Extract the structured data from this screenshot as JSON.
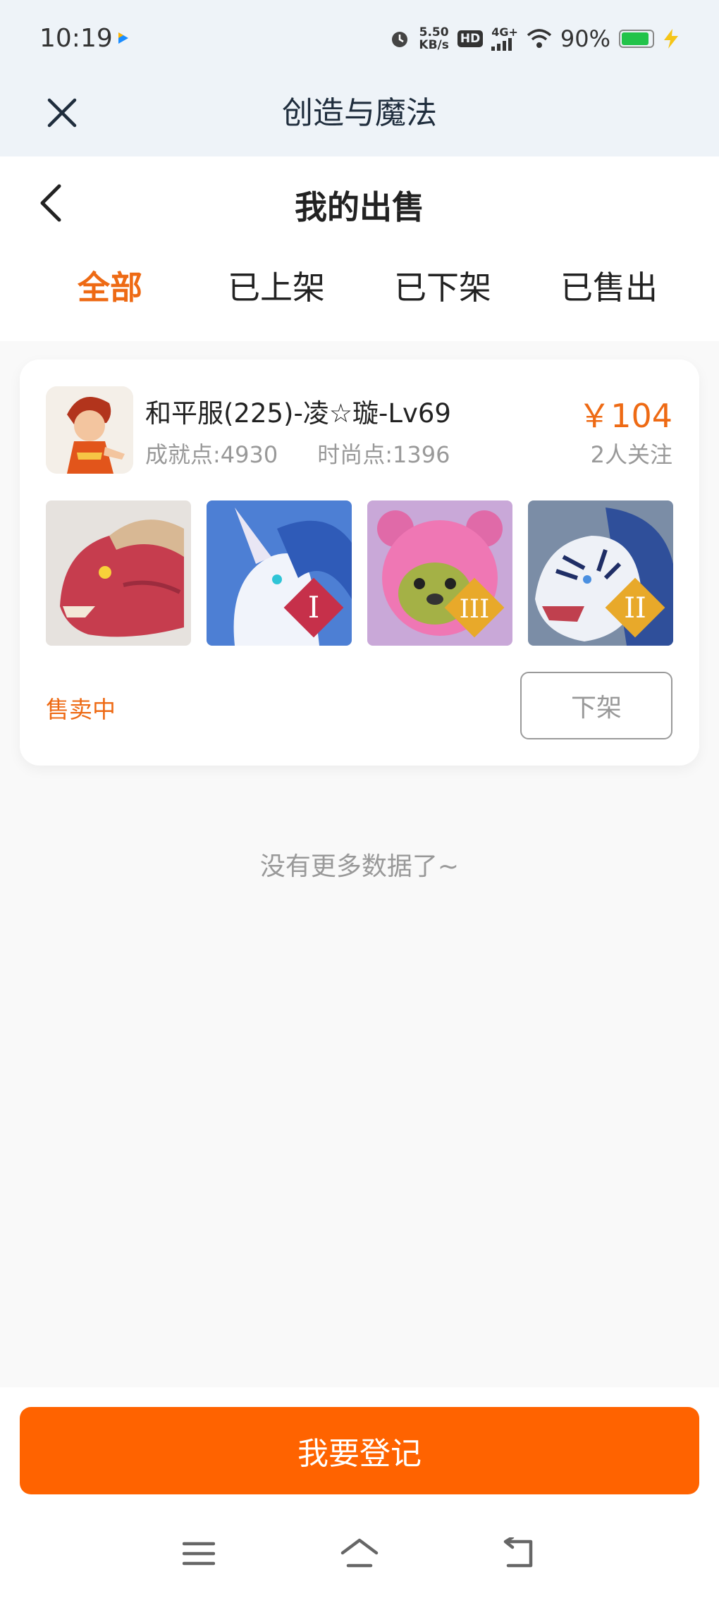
{
  "status_bar": {
    "time": "10:19",
    "net_speed_value": "5.50",
    "net_speed_unit": "KB/s",
    "hd": "HD",
    "network": "4G+",
    "battery": "90%",
    "battery_level": 0.9
  },
  "app": {
    "title": "创造与魔法"
  },
  "header": {
    "title": "我的出售",
    "tabs": [
      {
        "label": "全部",
        "active": true
      },
      {
        "label": "已上架",
        "active": false
      },
      {
        "label": "已下架",
        "active": false
      },
      {
        "label": "已售出",
        "active": false
      }
    ]
  },
  "listing": {
    "account_name": "和平服(225)-凌☆璇-Lv69",
    "achievement": "成就点:4930",
    "fashion": "时尚点:1396",
    "price": "￥104",
    "followers": "2人关注",
    "items": [
      {
        "icon": "red-dragon-mount"
      },
      {
        "icon": "blue-unicorn-mount",
        "badge": "I"
      },
      {
        "icon": "pink-bear-pet",
        "badge": "III"
      },
      {
        "icon": "white-tiger-mount",
        "badge": "II"
      }
    ],
    "status": "售卖中",
    "delist_label": "下架"
  },
  "list_end": "没有更多数据了~",
  "footer": {
    "register_label": "我要登记"
  },
  "colors": {
    "accent": "#ff6300",
    "accent_text": "#ee6a14"
  }
}
